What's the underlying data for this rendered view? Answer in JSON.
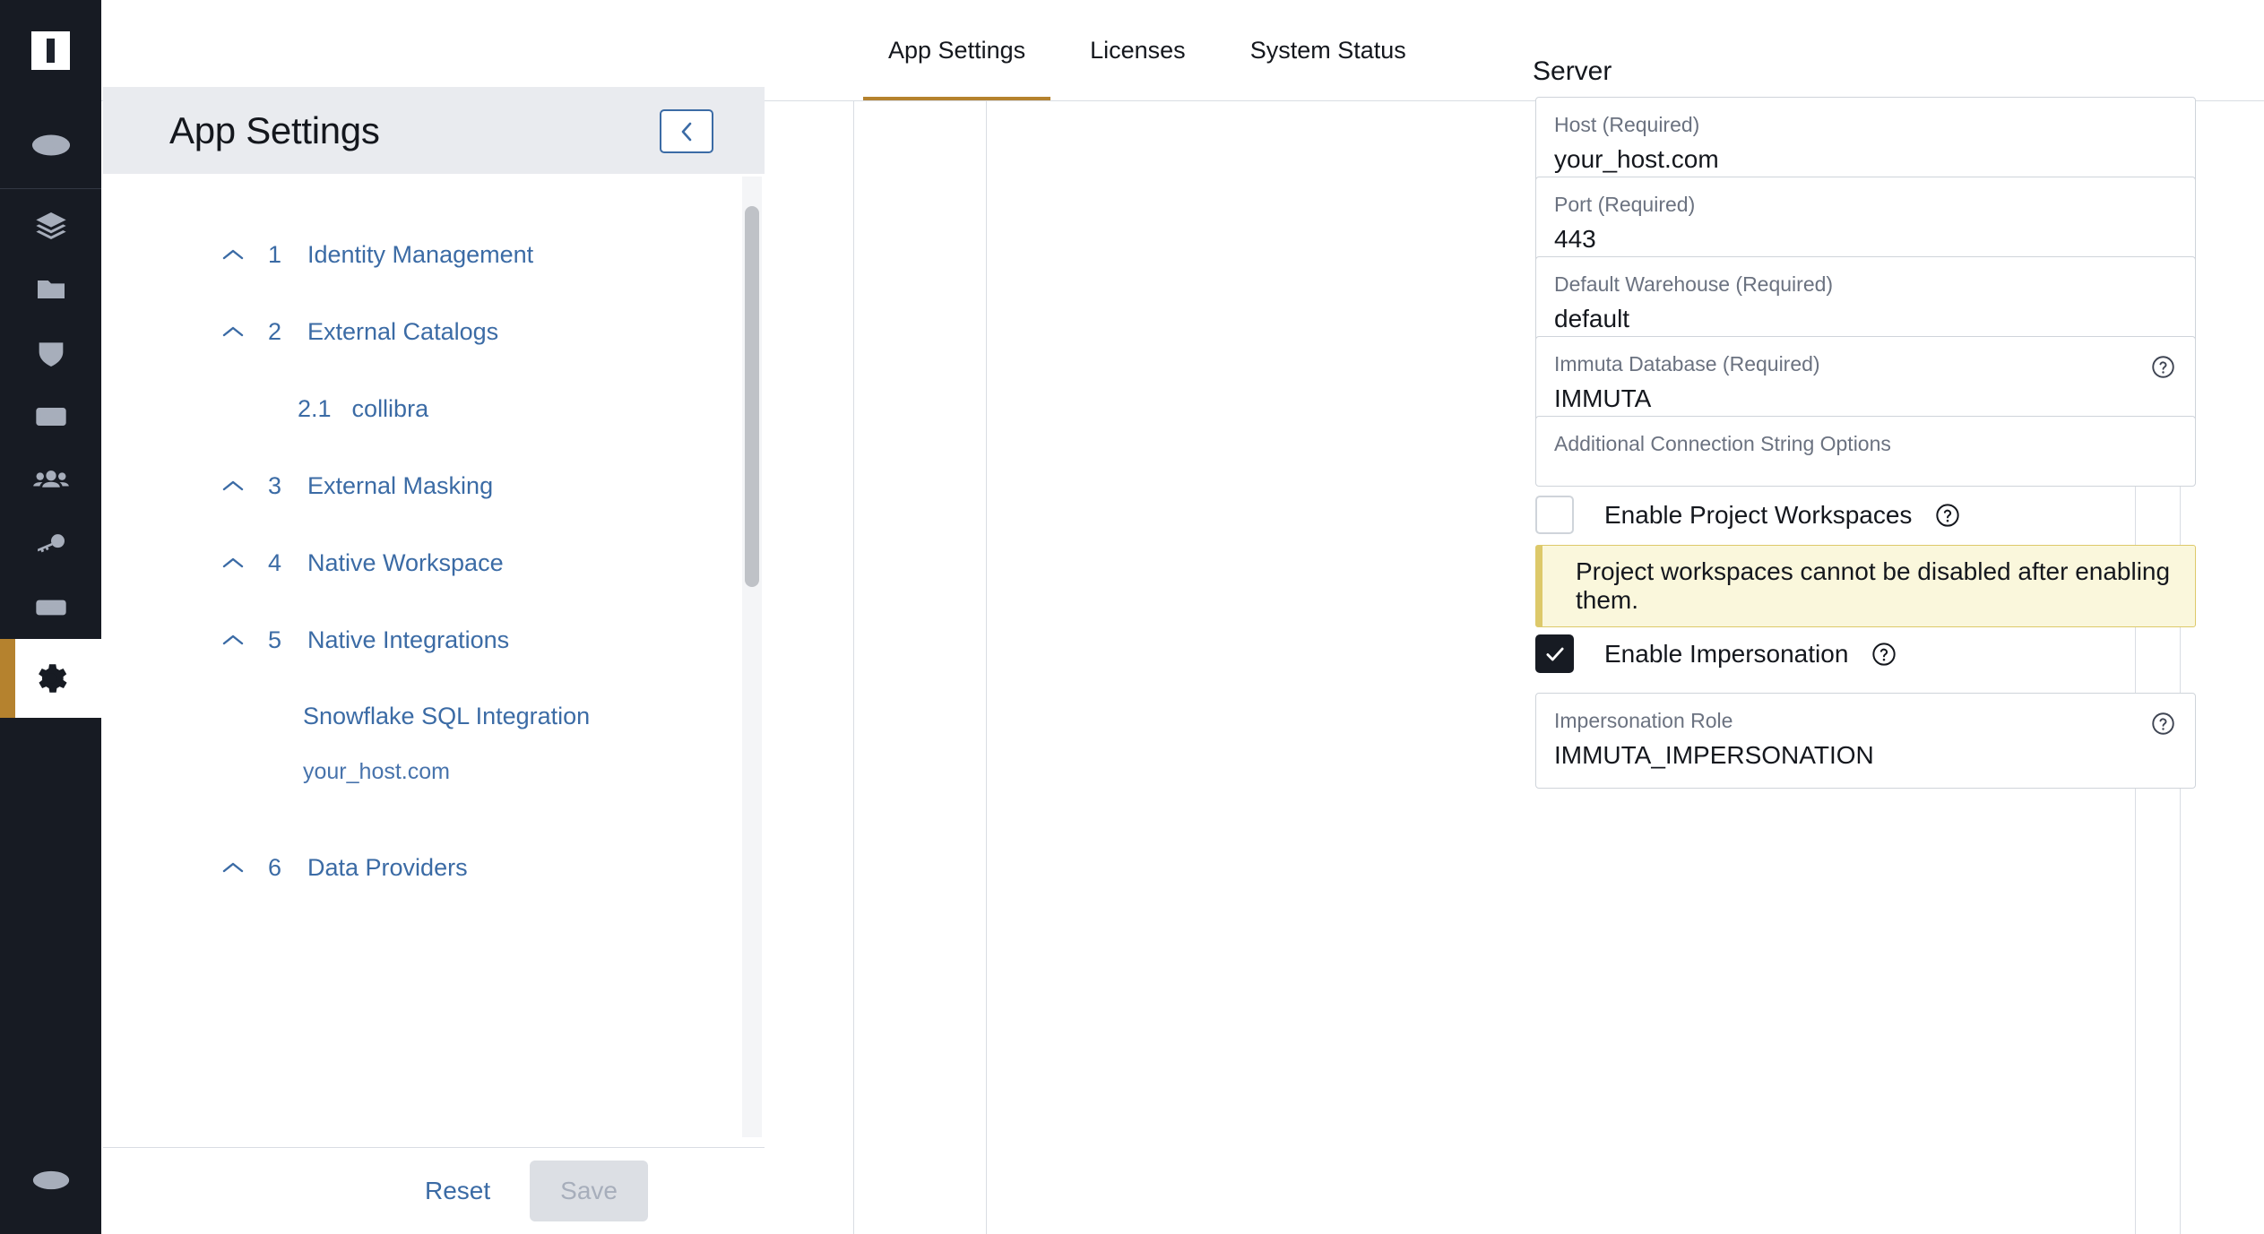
{
  "rail": {
    "logo_name": "immuta-logo",
    "items": [
      {
        "icon": "plus-circle-icon",
        "name": "add-button"
      },
      {
        "icon": "layers-icon",
        "name": "data-sources"
      },
      {
        "icon": "folder-icon",
        "name": "projects"
      },
      {
        "icon": "shield-icon",
        "name": "policies"
      },
      {
        "icon": "terminal-icon",
        "name": "query-engine"
      },
      {
        "icon": "people-icon",
        "name": "people"
      },
      {
        "icon": "key-icon",
        "name": "governance"
      },
      {
        "icon": "document-icon",
        "name": "audit"
      },
      {
        "icon": "gear-icon",
        "name": "app-settings"
      }
    ],
    "bottom_icon": "logout-icon",
    "active_index": 8,
    "active_accent": "#b5822e"
  },
  "tabs": [
    {
      "label": "App Settings",
      "active": true
    },
    {
      "label": "Licenses",
      "active": false
    },
    {
      "label": "System Status",
      "active": false
    }
  ],
  "nav": {
    "title": "App Settings",
    "collapse_icon": "chevron-left-icon",
    "sections": [
      {
        "num": "1",
        "label": "Identity Management",
        "chevron": "chevron-up-icon"
      },
      {
        "num": "2",
        "label": "External Catalogs",
        "chevron": "chevron-up-icon"
      }
    ],
    "sub_item": {
      "num": "2.1",
      "label": "collibra"
    },
    "sections2": [
      {
        "num": "3",
        "label": "External Masking",
        "chevron": "chevron-up-icon"
      },
      {
        "num": "4",
        "label": "Native Workspace",
        "chevron": "chevron-up-icon"
      },
      {
        "num": "5",
        "label": "Native Integrations",
        "chevron": "chevron-up-icon"
      }
    ],
    "integration": {
      "name": "Snowflake SQL Integration",
      "host": "your_host.com"
    },
    "sections3": [
      {
        "num": "6",
        "label": "Data Providers",
        "chevron": "chevron-up-icon"
      }
    ],
    "footer": {
      "reset_label": "Reset",
      "save_label": "Save"
    }
  },
  "form": {
    "section_title": "Server",
    "fields": [
      {
        "label": "Host (Required)",
        "value": "your_host.com",
        "help": false
      },
      {
        "label": "Port (Required)",
        "value": "443",
        "help": false
      },
      {
        "label": "Default Warehouse (Required)",
        "value": "default",
        "help": false
      },
      {
        "label": "Immuta Database (Required)",
        "value": "IMMUTA",
        "help": true
      },
      {
        "label": "Additional Connection String Options",
        "value": "",
        "help": false
      }
    ],
    "checkbox_workspaces": {
      "label": "Enable Project Workspaces",
      "checked": false,
      "help_icon": "question-circle-icon"
    },
    "notice": {
      "text": "Project workspaces cannot be disabled after enabling them.",
      "bg": "#faf7dc",
      "border": "#ddc96a"
    },
    "checkbox_impersonation": {
      "label": "Enable Impersonation",
      "checked": true,
      "help_icon": "question-circle-icon"
    },
    "impersonation_role": {
      "label": "Impersonation Role",
      "value": "IMMUTA_IMPERSONATION",
      "help": true
    }
  }
}
